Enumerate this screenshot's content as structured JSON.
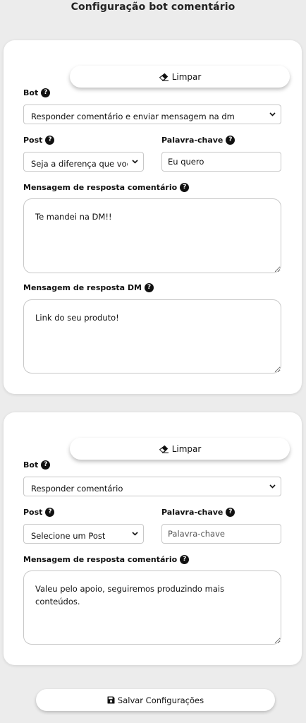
{
  "page": {
    "title": "Configuração bot comentário",
    "save_label": "Salvar Configurações"
  },
  "icons": {
    "clear": "eraser-icon",
    "help": "question-circle-icon",
    "dropdown": "chevron-down-icon",
    "save": "floppy-disk-icon"
  },
  "help_glyph": "?",
  "cards": [
    {
      "clear_label": "Limpar",
      "bot_label": "Bot",
      "bot_value": "Responder comentário e enviar mensagem na dm",
      "post_label": "Post",
      "post_value": "Seja a diferença que você",
      "keyword_label": "Palavra-chave",
      "keyword_value": "Eu quero",
      "keyword_placeholder": "Palavra-chave",
      "comment_reply_label": "Mensagem de resposta comentário",
      "comment_reply_value": "Te mandei na DM!!",
      "dm_reply_label": "Mensagem de resposta DM",
      "dm_reply_value": "Link do seu produto!"
    },
    {
      "clear_label": "Limpar",
      "bot_label": "Bot",
      "bot_value": "Responder comentário",
      "post_label": "Post",
      "post_value": "Selecione um Post",
      "keyword_label": "Palavra-chave",
      "keyword_value": "",
      "keyword_placeholder": "Palavra-chave",
      "comment_reply_label": "Mensagem de resposta comentário",
      "comment_reply_value": "Valeu pelo apoio, seguiremos produzindo mais conteúdos."
    }
  ]
}
